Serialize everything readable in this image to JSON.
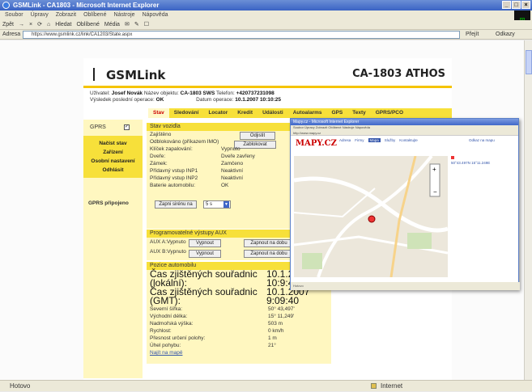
{
  "window": {
    "title": "GSMLink - CA1803 - Microsoft Internet Explorer",
    "controls": [
      "_",
      "□",
      "×"
    ]
  },
  "menubar": [
    "Soubor",
    "Úpravy",
    "Zobrazit",
    "Oblíbené",
    "Nástroje",
    "Nápověda"
  ],
  "toolbar": [
    "Zpět",
    "→",
    "×",
    "⟳",
    "⌂",
    "Hledat",
    "Oblíbené",
    "Média",
    "✉",
    "✎",
    "☐"
  ],
  "address": {
    "label": "Adresa",
    "url": "https://www.gsmlink.cz/link/CA1203/State.aspx",
    "go": "Přejít",
    "links": "Odkazy"
  },
  "page": {
    "logo": "GSMLink",
    "device": "CA-1803 ATHOS",
    "user_label": "Uživatel:",
    "user": "Josef Novák",
    "object_label": "Název objektu:",
    "object": "CA-1803 SWS",
    "phone_label": "Telefon:",
    "phone": "+420737231098",
    "result_label": "Výsledek poslední operace:",
    "result": "OK",
    "date_label": "Datum operace:",
    "date": "10.1.2007 10:10:25",
    "tabs": [
      "Stav",
      "Sledování",
      "Locator",
      "Kredit",
      "Události",
      "Autoalarms",
      "GPS",
      "Texty",
      "GPRS/PCO"
    ]
  },
  "sidebar": {
    "gprs": "GPRS",
    "gprs_checked": "✓",
    "items": [
      "Načíst stav",
      "Zařízení",
      "Osobní nastavení",
      "Odhlásit"
    ],
    "connected": "GPRS připojeno"
  },
  "vehicle": {
    "heading": "Stav vozidla",
    "security": "Zajištěno",
    "unlocked": "Odblokováno (příkazem IMO)",
    "btn_unsecure": "Odjistit",
    "btn_block": "Zablokovat",
    "rows": [
      {
        "label": "Klíček zapalování:",
        "value": "Vypnuto"
      },
      {
        "label": "Dveře:",
        "value": "Dveře zavřeny"
      },
      {
        "label": "Zámek:",
        "value": "Zamčeno"
      },
      {
        "label": "Přídavný vstup INP1",
        "value": "Neaktivní"
      },
      {
        "label": "Přídavný vstup INP2",
        "value": "Neaktivní"
      },
      {
        "label": "Baterie automobilu:",
        "value": "OK"
      }
    ],
    "btn_siren": "Zapni sirénu na",
    "siren_value": "5 s"
  },
  "outputs": {
    "heading": "Programovatelné výstupy AUX",
    "aux_a": "AUX A:Vypnuto",
    "aux_b": "AUX B:Vypnuto",
    "btn_off": "Vypnout",
    "btn_on_for": "Zapnout na dobu"
  },
  "position": {
    "heading": "Pozice automobilu",
    "local_label": "Čas zjištěných souřadnic (lokální):",
    "local_value": "10.1.2007 10:9:40",
    "gmt_label": "Čas zjištěných souřadnic (GMT):",
    "gmt_value": "10.1.2007 9:09:40",
    "rows": [
      {
        "label": "Severní šířka:",
        "value": "50° 43,497'"
      },
      {
        "label": "Východní délka:",
        "value": "15° 11,249'"
      },
      {
        "label": "Nadmořská výška:",
        "value": "503 m"
      },
      {
        "label": "Rychlost:",
        "value": "0 km/h"
      },
      {
        "label": "Přesnost určení polohy:",
        "value": "1 m"
      },
      {
        "label": "Úhel pohybu:",
        "value": "21°"
      }
    ],
    "map_link": "Najít na mapě"
  },
  "popup": {
    "title": "Mapy.cz - Microsoft Internet Explorer",
    "brand": "MAPY.CZ",
    "nav": [
      "Adresa",
      "Firmy",
      "Mapa",
      "Služby",
      "Kontaktujte"
    ],
    "right": "Odkaz na mapu",
    "coords": "50°43.497N 15°11.249E",
    "status": "Hotovo"
  },
  "statusbar": {
    "left": "Hotovo",
    "zone": "Internet"
  }
}
